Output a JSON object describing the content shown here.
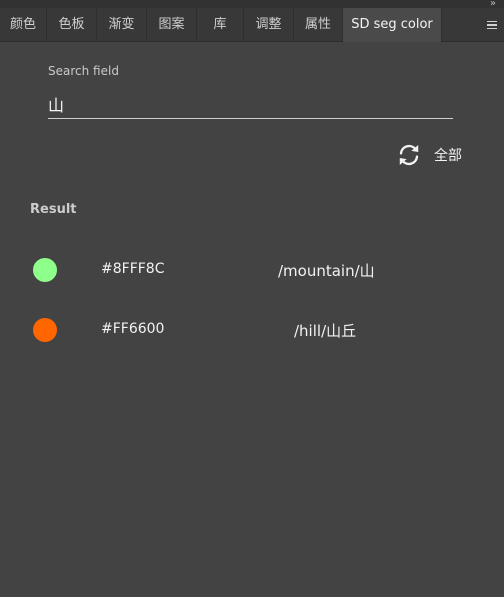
{
  "tabs": [
    {
      "label": "颜色"
    },
    {
      "label": "色板"
    },
    {
      "label": "渐变"
    },
    {
      "label": "图案"
    },
    {
      "label": "库"
    },
    {
      "label": "调整"
    },
    {
      "label": "属性"
    },
    {
      "label": "SD seg color",
      "active": true
    }
  ],
  "collapse_glyph": "»",
  "search": {
    "label": "Search field",
    "value": "山"
  },
  "refresh": {
    "icon": "refresh-icon",
    "label": "全部"
  },
  "results": {
    "title": "Result",
    "items": [
      {
        "color": "#8FFF8C",
        "hex": "#8FFF8C",
        "path": "/mountain/山"
      },
      {
        "color": "#FF6600",
        "hex": "#FF6600",
        "path": "/hill/山丘"
      }
    ]
  },
  "colors": {
    "background": "#434343",
    "tabbar": "#383838",
    "active_tab": "#4a4a4a"
  }
}
